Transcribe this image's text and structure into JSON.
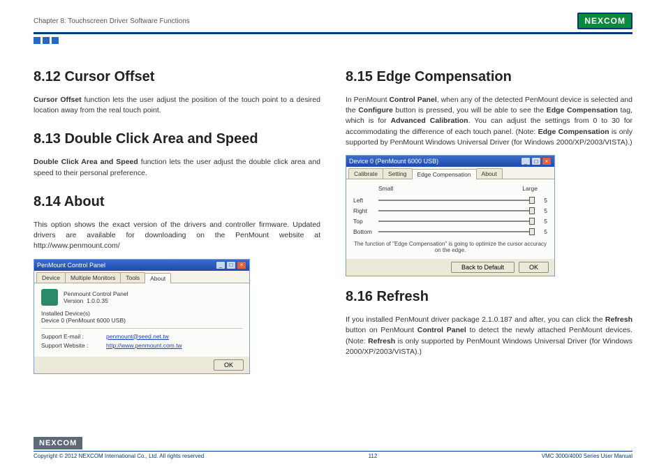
{
  "header": {
    "chapter": "Chapter 8: Touchscreen Driver Software Functions",
    "brand": "NEXCOM"
  },
  "left": {
    "s812": {
      "h": "8.12  Cursor Offset",
      "p": "Cursor Offset function lets the user adjust the position of the touch point to a desired location away from the real touch point.",
      "b": "Cursor Offset"
    },
    "s813": {
      "h": "8.13  Double Click Area and Speed",
      "p": "Double Click Area and Speed function lets the user adjust the double click area and speed to their personal preference.",
      "b": "Double Click Area and Speed"
    },
    "s814": {
      "h": "8.14  About",
      "p": "This option shows the exact version of the drivers and controller firmware. Updated drivers are available for downloading on the PenMount website at http://www.penmount.com/"
    },
    "win1": {
      "title": "PenMount Control Panel",
      "tabs": [
        "Device",
        "Multiple Monitors",
        "Tools",
        "About"
      ],
      "active": 3,
      "name": "Penmount Control Panel",
      "verlbl": "Version",
      "ver": "1.0.0.35",
      "instlbl": "Installed Device(s)",
      "dev": "Device 0 (PenMount 6000 USB)",
      "emaillbl": "Support E-mail :",
      "email": "penmount@seed.net.tw",
      "weblbl": "Support Website :",
      "web": "http://www.penmount.com.tw",
      "ok": "OK"
    }
  },
  "right": {
    "s815": {
      "h": "8.15  Edge Compensation",
      "p": "In PenMount Control Panel, when any of the detected PenMount device is selected and the Configure button is pressed, you will be able to see the Edge Compensation tag, which is for Advanced Calibration. You can adjust the settings from 0 to 30 for accommodating the difference of each touch panel. (Note: Edge Compensation is only supported by PenMount Windows Universal Driver (for Windows 2000/XP/2003/VISTA).)",
      "b1": "Control Panel",
      "b2": "Configure",
      "b3": "Edge Compensation",
      "b4": "Advanced Calibration",
      "b5": "Edge Compensation"
    },
    "win2": {
      "title": "Device 0 (PenMount 6000 USB)",
      "tabs": [
        "Calibrate",
        "Setting",
        "Edge Compensation",
        "About"
      ],
      "active": 2,
      "small": "Small",
      "large": "Large",
      "rows": [
        {
          "lbl": "Left",
          "val": "5"
        },
        {
          "lbl": "Right",
          "val": "5"
        },
        {
          "lbl": "Top",
          "val": "5"
        },
        {
          "lbl": "Bottom",
          "val": "5"
        }
      ],
      "note": "The function of \"Edge Compensation\" is going to optimize the cursor accuracy on the edge.",
      "back": "Back to Default",
      "ok": "OK"
    },
    "s816": {
      "h": "8.16  Refresh",
      "p": "If you installed PenMount driver package 2.1.0.187 and after, you can click the Refresh button on PenMount Control Panel to detect the newly attached PenMount devices. (Note: Refresh is only supported by PenMount Windows Universal Driver (for Windows 2000/XP/2003/VISTA).)",
      "b1": "Refresh",
      "b2": "Control Panel",
      "b3": "Refresh"
    }
  },
  "footer": {
    "copy": "Copyright © 2012 NEXCOM International Co., Ltd. All rights reserved",
    "page": "112",
    "doc": "VMC 3000/4000 Series User Manual",
    "brand": "NEXCOM"
  }
}
